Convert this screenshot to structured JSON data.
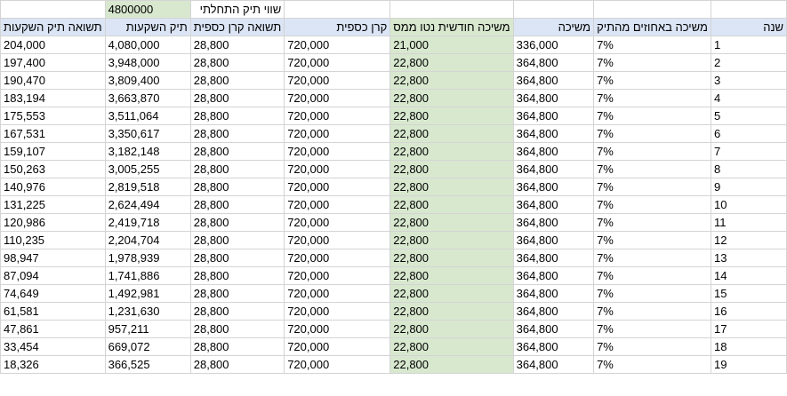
{
  "top_row": {
    "initial_label": "שווי תיק התחלתי",
    "initial_value": "4800000"
  },
  "headers": [
    "שנה",
    "משיכה באחוזים מהתיק",
    "משיכה",
    "משיכה חודשית נטו ממס",
    "קרן כספית",
    "תשואה קרן כספית",
    "תיק השקעות",
    "תשואה תיק השקעות"
  ],
  "rows": [
    [
      "1",
      "7%",
      "336,000",
      "21,000",
      "720,000",
      "28,800",
      "4,080,000",
      "204,000"
    ],
    [
      "2",
      "7%",
      "364,800",
      "22,800",
      "720,000",
      "28,800",
      "3,948,000",
      "197,400"
    ],
    [
      "3",
      "7%",
      "364,800",
      "22,800",
      "720,000",
      "28,800",
      "3,809,400",
      "190,470"
    ],
    [
      "4",
      "7%",
      "364,800",
      "22,800",
      "720,000",
      "28,800",
      "3,663,870",
      "183,194"
    ],
    [
      "5",
      "7%",
      "364,800",
      "22,800",
      "720,000",
      "28,800",
      "3,511,064",
      "175,553"
    ],
    [
      "6",
      "7%",
      "364,800",
      "22,800",
      "720,000",
      "28,800",
      "3,350,617",
      "167,531"
    ],
    [
      "7",
      "7%",
      "364,800",
      "22,800",
      "720,000",
      "28,800",
      "3,182,148",
      "159,107"
    ],
    [
      "8",
      "7%",
      "364,800",
      "22,800",
      "720,000",
      "28,800",
      "3,005,255",
      "150,263"
    ],
    [
      "9",
      "7%",
      "364,800",
      "22,800",
      "720,000",
      "28,800",
      "2,819,518",
      "140,976"
    ],
    [
      "10",
      "7%",
      "364,800",
      "22,800",
      "720,000",
      "28,800",
      "2,624,494",
      "131,225"
    ],
    [
      "11",
      "7%",
      "364,800",
      "22,800",
      "720,000",
      "28,800",
      "2,419,718",
      "120,986"
    ],
    [
      "12",
      "7%",
      "364,800",
      "22,800",
      "720,000",
      "28,800",
      "2,204,704",
      "110,235"
    ],
    [
      "13",
      "7%",
      "364,800",
      "22,800",
      "720,000",
      "28,800",
      "1,978,939",
      "98,947"
    ],
    [
      "14",
      "7%",
      "364,800",
      "22,800",
      "720,000",
      "28,800",
      "1,741,886",
      "87,094"
    ],
    [
      "15",
      "7%",
      "364,800",
      "22,800",
      "720,000",
      "28,800",
      "1,492,981",
      "74,649"
    ],
    [
      "16",
      "7%",
      "364,800",
      "22,800",
      "720,000",
      "28,800",
      "1,231,630",
      "61,581"
    ],
    [
      "17",
      "7%",
      "364,800",
      "22,800",
      "720,000",
      "28,800",
      "957,211",
      "47,861"
    ],
    [
      "18",
      "7%",
      "364,800",
      "22,800",
      "720,000",
      "28,800",
      "669,072",
      "33,454"
    ],
    [
      "19",
      "7%",
      "364,800",
      "22,800",
      "720,000",
      "28,800",
      "366,525",
      "18,326"
    ]
  ],
  "colors": {
    "header_bg": "#dbe5f5",
    "highlight_green": "#d8e8cf",
    "grid": "#d4d4d4"
  }
}
